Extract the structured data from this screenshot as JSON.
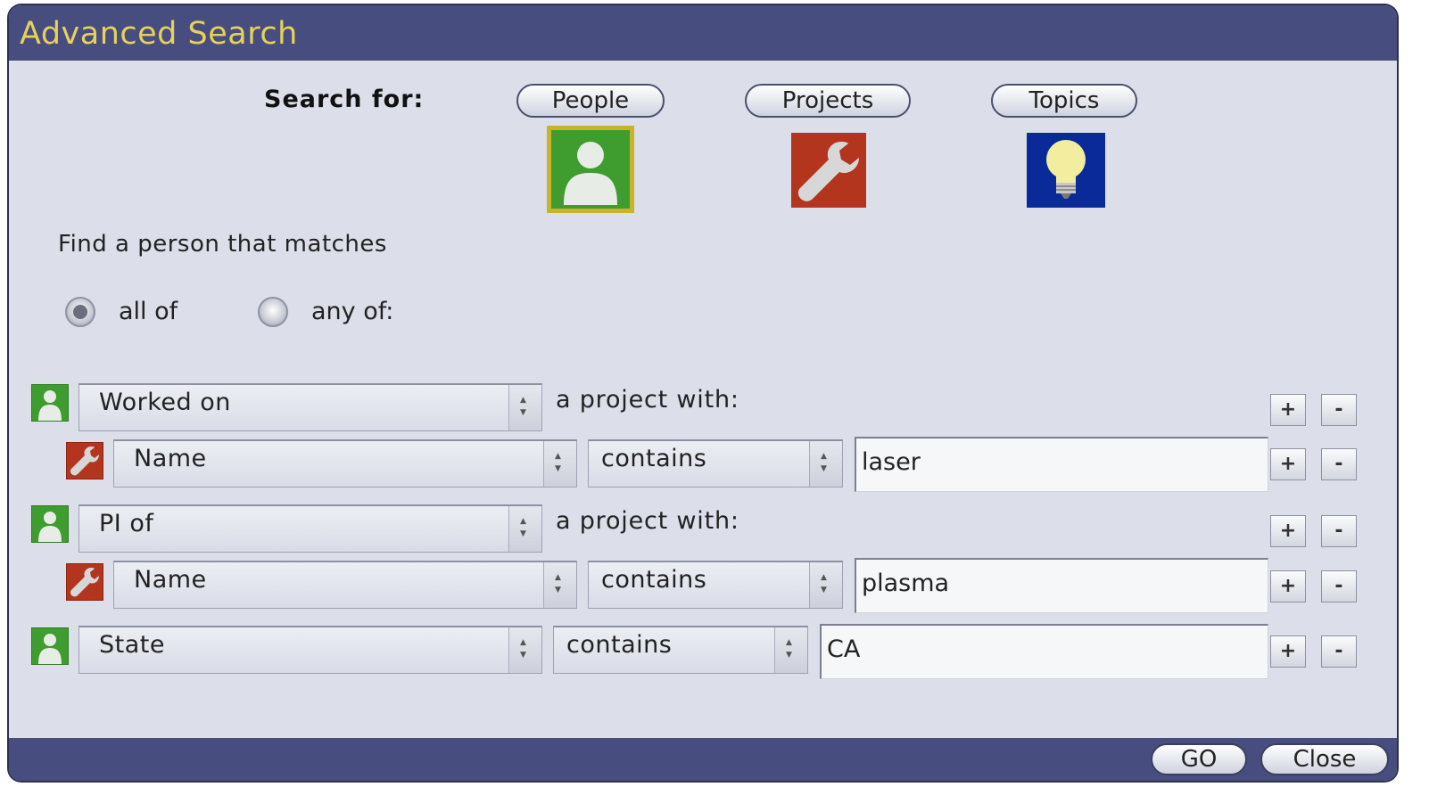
{
  "window": {
    "title": "Advanced Search"
  },
  "search_for": {
    "label": "Search for:",
    "options": [
      {
        "label": "People",
        "icon": "person-icon",
        "color": "#3f9d2f",
        "selected": true
      },
      {
        "label": "Projects",
        "icon": "wrench-icon",
        "color": "#b3351e",
        "selected": false
      },
      {
        "label": "Topics",
        "icon": "lightbulb-icon",
        "color": "#0a2a9a",
        "selected": false
      }
    ]
  },
  "match": {
    "prompt": "Find a person  that matches",
    "all_label": "all of",
    "any_label": "any of:",
    "selected": "all of"
  },
  "criteria": [
    {
      "icon": "person-icon",
      "field": "Worked on",
      "text": "a  project  with:"
    },
    {
      "icon": "wrench-icon",
      "field": "Name",
      "operator": "contains",
      "value": "laser"
    },
    {
      "icon": "person-icon",
      "field": "PI of",
      "text": "a  project  with:"
    },
    {
      "icon": "wrench-icon",
      "field": "Name",
      "operator": "contains",
      "value": "plasma"
    },
    {
      "icon": "person-icon",
      "field": "State",
      "operator": "contains",
      "value": "CA"
    }
  ],
  "row_buttons": {
    "add": "+",
    "remove": "-"
  },
  "footer": {
    "go": "GO",
    "close": "Close"
  }
}
